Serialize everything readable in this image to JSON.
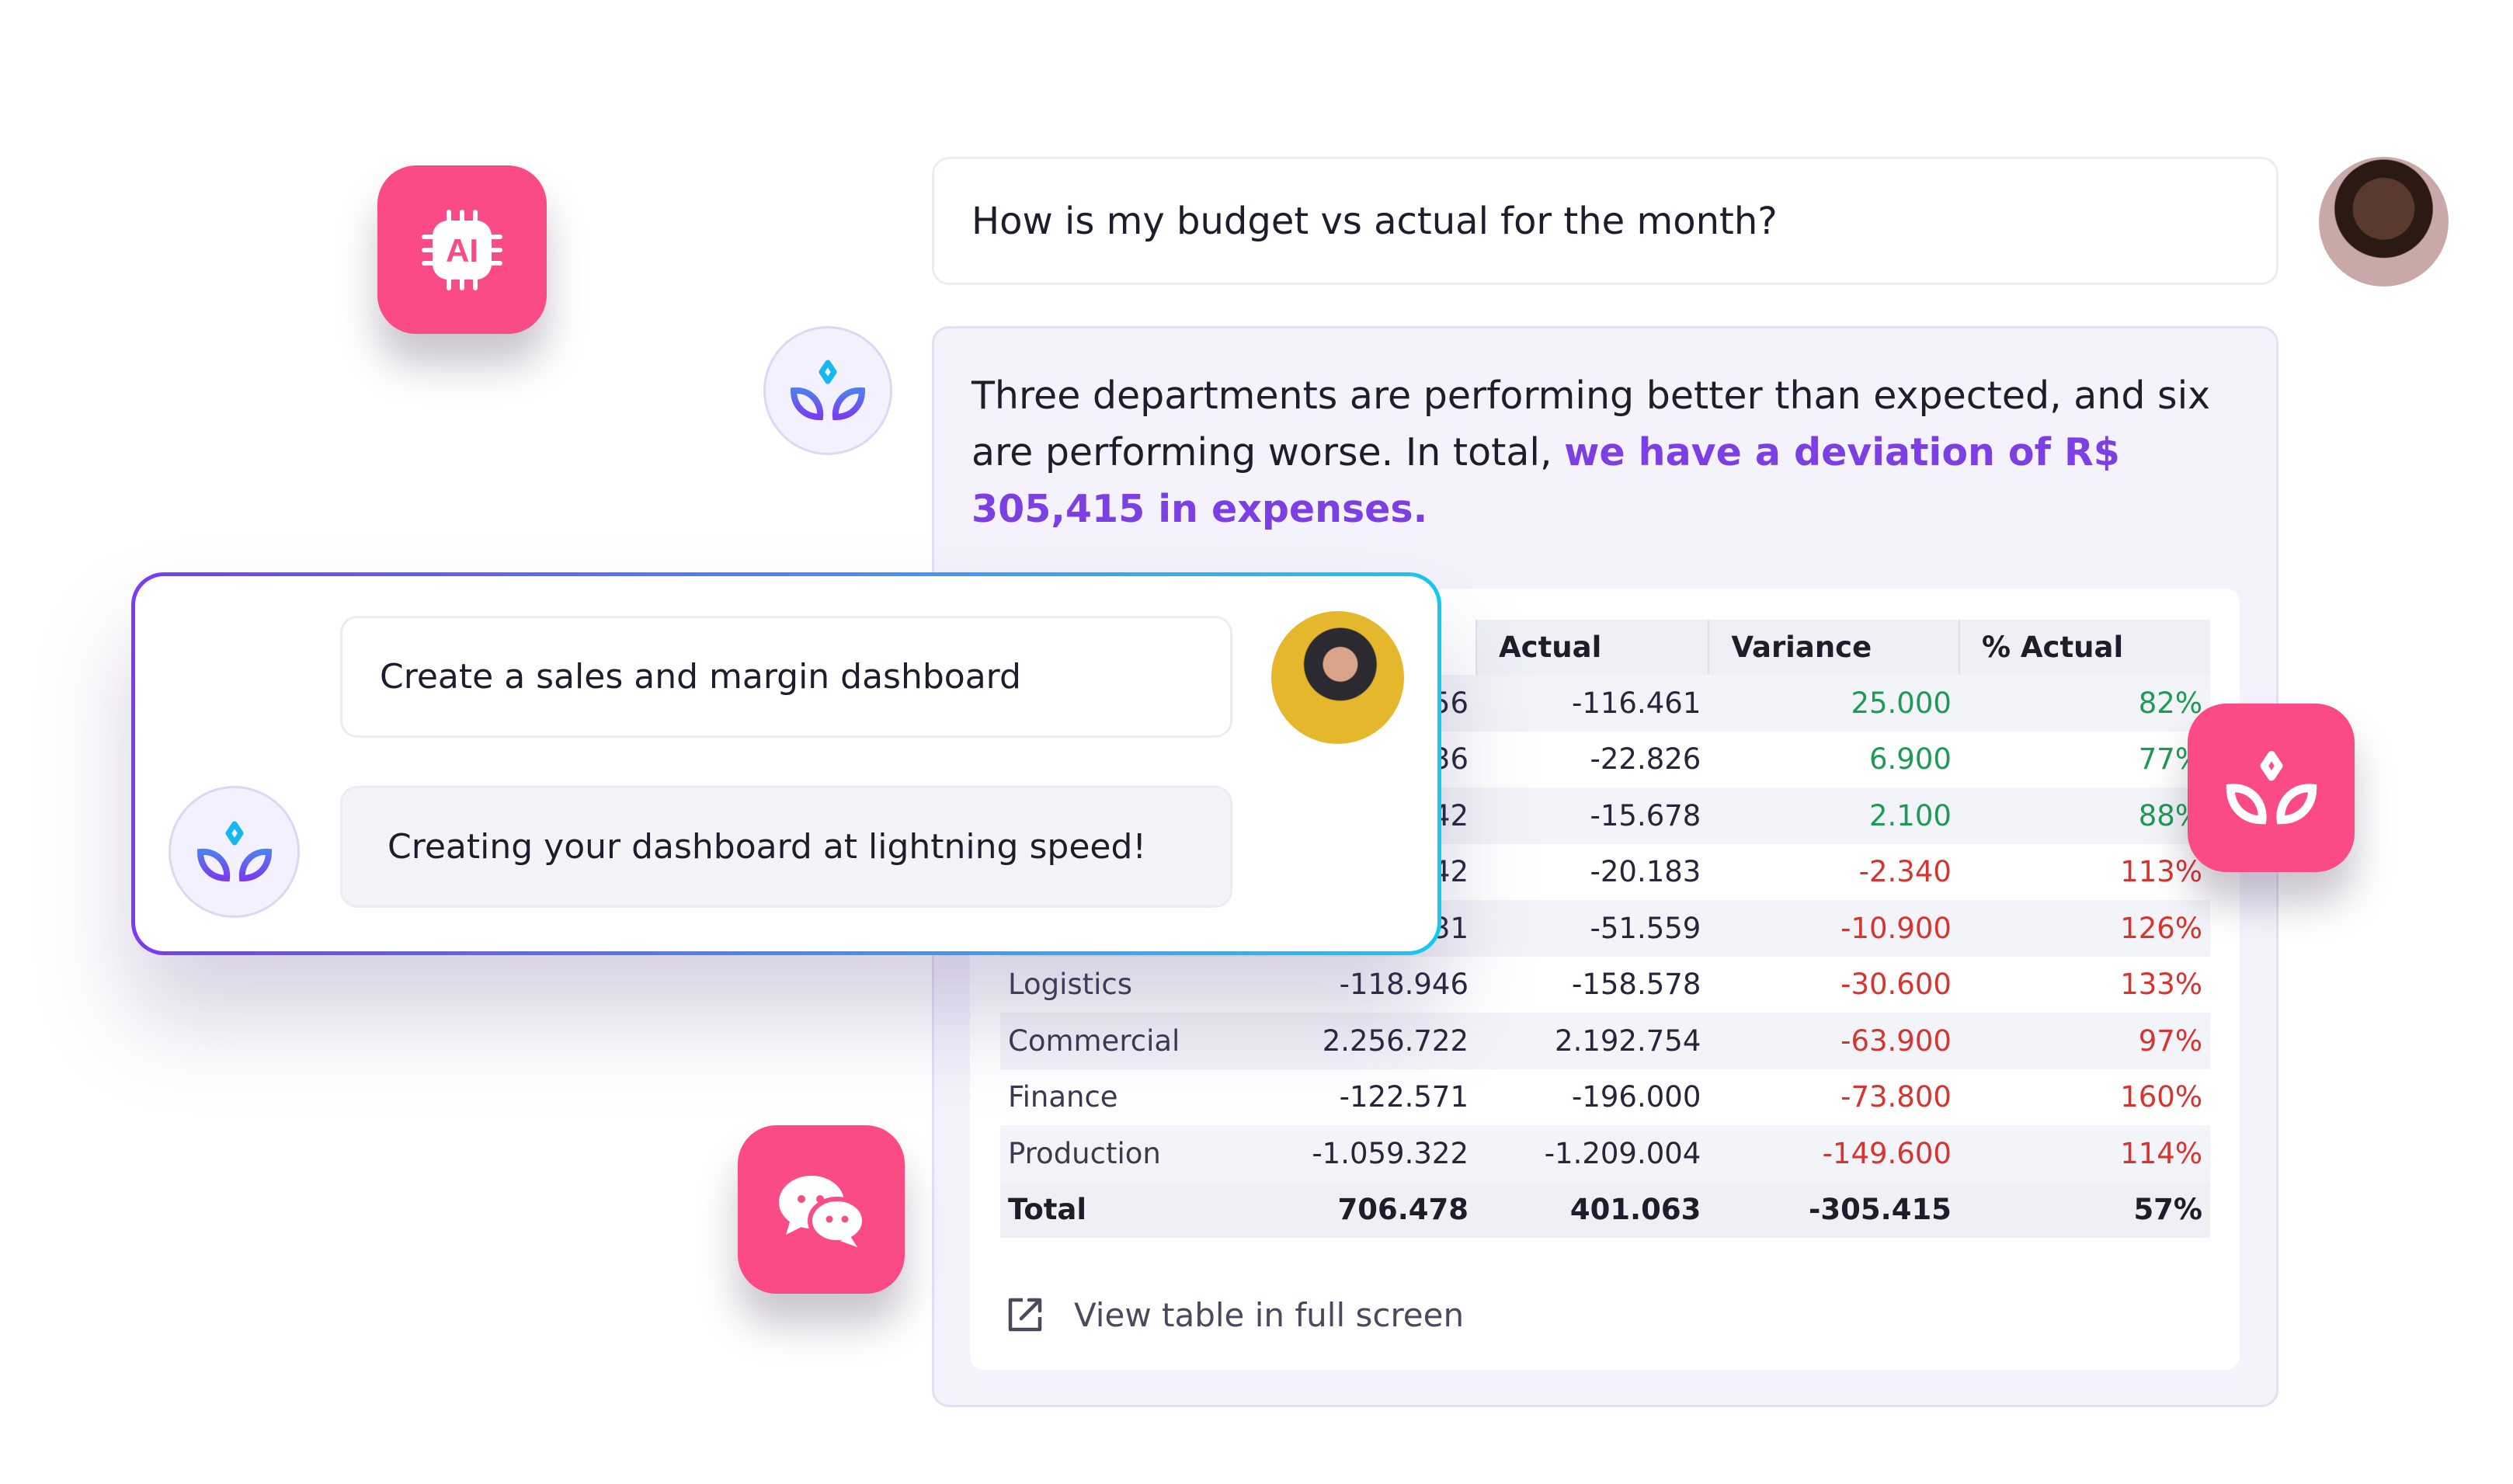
{
  "user_message": "How is my budget vs actual for the month?",
  "assistant_reply": {
    "text_plain": "Three departments are performing better than expected, and six are performing worse. In total, ",
    "text_highlight": "we have a deviation of R$ 305,415 in expenses."
  },
  "table": {
    "headers": [
      "Actual",
      "Variance",
      "% Actual"
    ],
    "rows": [
      {
        "name": "",
        "budget": "56",
        "actual": "-116.461",
        "variance": "25.000",
        "pct": "82%",
        "status": "pos"
      },
      {
        "name": "",
        "budget": "36",
        "actual": "-22.826",
        "variance": "6.900",
        "pct": "77%",
        "status": "pos"
      },
      {
        "name": "",
        "budget": "42",
        "actual": "-15.678",
        "variance": "2.100",
        "pct": "88%",
        "status": "pos"
      },
      {
        "name": "",
        "budget": "42",
        "actual": "-20.183",
        "variance": "-2.340",
        "pct": "113%",
        "status": "neg"
      },
      {
        "name": "",
        "budget": "31",
        "actual": "-51.559",
        "variance": "-10.900",
        "pct": "126%",
        "status": "neg"
      },
      {
        "name": "Logistics",
        "budget": "-118.946",
        "actual": "-158.578",
        "variance": "-30.600",
        "pct": "133%",
        "status": "neg"
      },
      {
        "name": "Commercial",
        "budget": "2.256.722",
        "actual": "2.192.754",
        "variance": "-63.900",
        "pct": "97%",
        "status": "neg"
      },
      {
        "name": "Finance",
        "budget": "-122.571",
        "actual": "-196.000",
        "variance": "-73.800",
        "pct": "160%",
        "status": "neg"
      },
      {
        "name": "Production",
        "budget": "-1.059.322",
        "actual": "-1.209.004",
        "variance": "-149.600",
        "pct": "114%",
        "status": "neg"
      }
    ],
    "total": {
      "name": "Total",
      "budget": "706.478",
      "actual": "401.063",
      "variance": "-305.415",
      "pct": "57%"
    }
  },
  "view_fullscreen_label": "View table in full screen",
  "dashboard_chat": {
    "user_message": "Create a sales and margin dashboard",
    "assistant_reply": "Creating your dashboard at lightning speed!"
  },
  "icons": {
    "ai_chip": "ai-chip-icon",
    "bot": "lotus-logo-icon",
    "chat": "chat-bubbles-icon",
    "expand": "external-link-icon"
  },
  "colors": {
    "accent_pink": "#fb4b87",
    "highlight_purple": "#7b3fe4",
    "positive": "#1f9a56",
    "negative": "#d8342f"
  }
}
